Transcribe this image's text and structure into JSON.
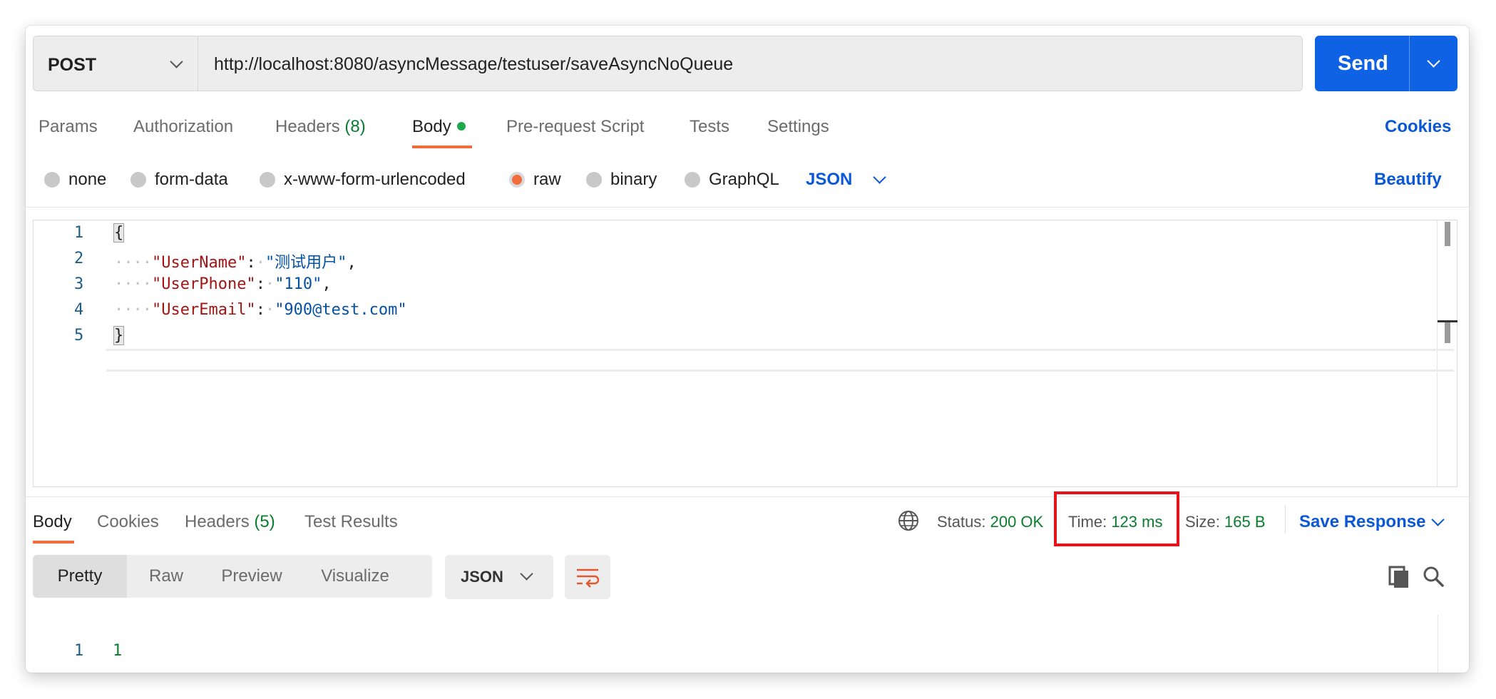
{
  "request": {
    "method": "POST",
    "url": "http://localhost:8080/asyncMessage/testuser/saveAsyncNoQueue",
    "send_label": "Send"
  },
  "request_tabs": {
    "params": "Params",
    "authorization": "Authorization",
    "headers": "Headers",
    "headers_count": "(8)",
    "body": "Body",
    "prerequest": "Pre-request Script",
    "tests": "Tests",
    "settings": "Settings",
    "cookies": "Cookies"
  },
  "body_types": {
    "none": "none",
    "form_data": "form-data",
    "urlencoded": "x-www-form-urlencoded",
    "raw": "raw",
    "binary": "binary",
    "graphql": "GraphQL",
    "format": "JSON",
    "beautify": "Beautify",
    "selected": "raw"
  },
  "editor": {
    "line_numbers": [
      "1",
      "2",
      "3",
      "4",
      "5"
    ],
    "open_brace": "{",
    "close_brace": "}",
    "lines": [
      {
        "key": "\"UserName\"",
        "value": "\"测试用户\"",
        "trail": ","
      },
      {
        "key": "\"UserPhone\"",
        "value": "\"110\"",
        "trail": ","
      },
      {
        "key": "\"UserEmail\"",
        "value": "\"900@test.com\"",
        "trail": ""
      }
    ],
    "indent_marks": "····"
  },
  "response": {
    "tabs": {
      "body": "Body",
      "cookies": "Cookies",
      "headers": "Headers",
      "headers_count": "(5)",
      "test_results": "Test Results"
    },
    "status_label": "Status:",
    "status_value": "200 OK",
    "time_label": "Time:",
    "time_value": "123 ms",
    "size_label": "Size:",
    "size_value": "165 B",
    "save_response": "Save Response",
    "views": {
      "pretty": "Pretty",
      "raw": "Raw",
      "preview": "Preview",
      "visualize": "Visualize"
    },
    "format": "JSON",
    "body_line_number": "1",
    "body_value": "1"
  },
  "colors": {
    "accent": "#f26b3a",
    "send_button": "#0f62e3",
    "link": "#0b58d6",
    "success": "#0a7d2e",
    "highlight_box": "#e8121b"
  }
}
